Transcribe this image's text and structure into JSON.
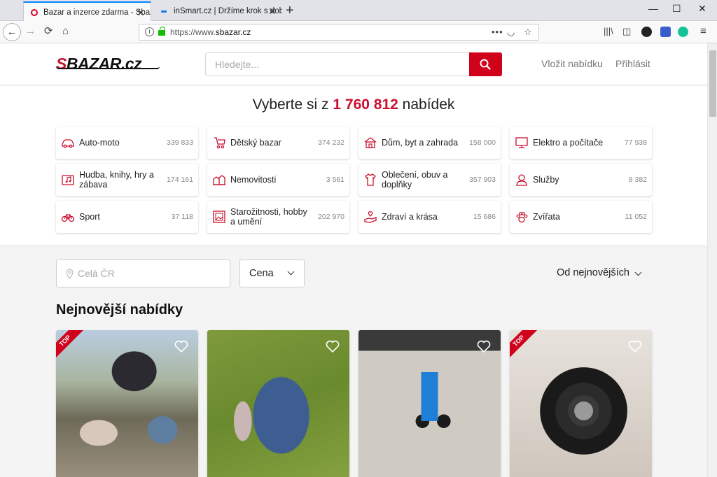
{
  "browser": {
    "tabs": [
      {
        "title": "Bazar a inzerce zdarma - Sbazar.cz",
        "active": true
      },
      {
        "title": "inSmart.cz | Držíme krok s dobou",
        "active": false
      }
    ],
    "url_prefix": "https://www.",
    "url_host": "sbazar.cz"
  },
  "header": {
    "logo_accent": "S",
    "logo_rest": "BAZAR.cz",
    "search_placeholder": "Hledejte...",
    "links": [
      "Vložit nabídku",
      "Přihlásit"
    ]
  },
  "hero": {
    "title_prefix": "Vyberte si z",
    "total_count": "1 760 812",
    "title_suffix": "nabídek"
  },
  "categories": [
    {
      "name": "Auto-moto",
      "count": "339 833",
      "icon": "car-icon"
    },
    {
      "name": "Dětský bazar",
      "count": "374 232",
      "icon": "stroller-icon"
    },
    {
      "name": "Dům, byt a zahrada",
      "count": "158 000",
      "icon": "house-icon"
    },
    {
      "name": "Elektro a počítače",
      "count": "77 938",
      "icon": "monitor-icon"
    },
    {
      "name": "Hudba, knihy, hry a zábava",
      "count": "174 161",
      "icon": "music-book-icon"
    },
    {
      "name": "Nemovitosti",
      "count": "3 561",
      "icon": "buildings-icon"
    },
    {
      "name": "Oblečení, obuv a doplňky",
      "count": "357 903",
      "icon": "shirt-icon"
    },
    {
      "name": "Služby",
      "count": "8 382",
      "icon": "person-service-icon"
    },
    {
      "name": "Sport",
      "count": "37 118",
      "icon": "bicycle-icon"
    },
    {
      "name": "Starožitnosti, hobby a umění",
      "count": "202 970",
      "icon": "picture-frame-icon"
    },
    {
      "name": "Zdraví a krása",
      "count": "15 686",
      "icon": "hand-heart-icon"
    },
    {
      "name": "Zvířata",
      "count": "11 052",
      "icon": "paw-icon"
    }
  ],
  "filters": {
    "location_placeholder": "Celá ČR",
    "price_label": "Cena",
    "sort_label": "Od nejnovějších"
  },
  "listings": {
    "title": "Nejnovější nabídky",
    "top_badge": "TOP",
    "items": [
      {
        "photo": "stroller-and-car-seat-photo",
        "top": true
      },
      {
        "photo": "denim-dress-with-toy-photo",
        "top": false
      },
      {
        "photo": "kids-balance-bike-photo",
        "top": false
      },
      {
        "photo": "car-tyre-with-alloy-rim-photo",
        "top": true
      }
    ]
  },
  "colors": {
    "brand_red": "#d0021b",
    "tab_accent": "#0a84ff",
    "secure_lock": "#12bc00"
  }
}
